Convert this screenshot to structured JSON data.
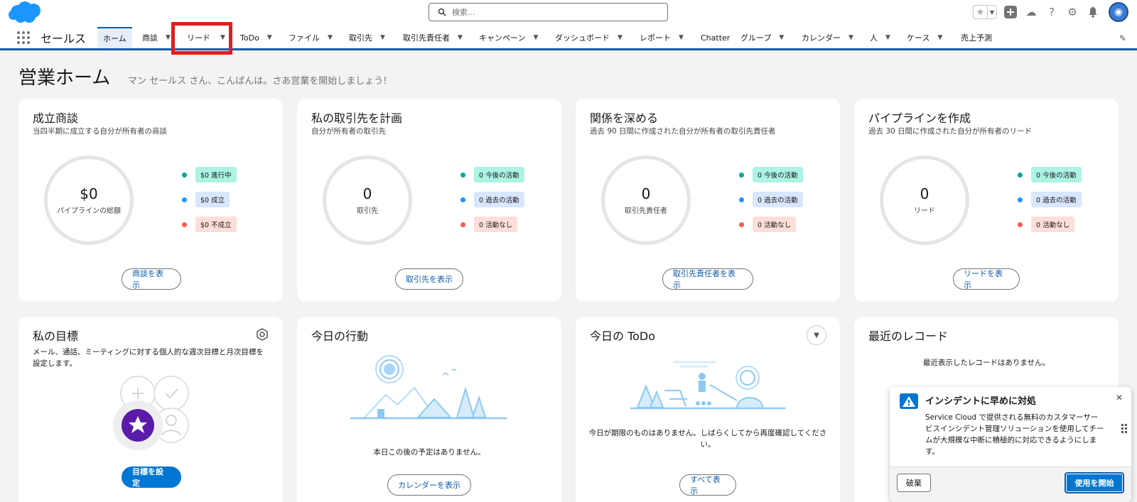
{
  "search": {
    "placeholder": "検索..."
  },
  "nav": {
    "app_name": "セールス",
    "items": [
      {
        "label": "ホーム"
      },
      {
        "label": "商談"
      },
      {
        "label": "リード"
      },
      {
        "label": "ToDo"
      },
      {
        "label": "ファイル"
      },
      {
        "label": "取引先"
      },
      {
        "label": "取引先責任者"
      },
      {
        "label": "キャンペーン"
      },
      {
        "label": "ダッシュボード"
      },
      {
        "label": "レポート"
      },
      {
        "label": "Chatter"
      },
      {
        "label": "グループ"
      },
      {
        "label": "カレンダー"
      },
      {
        "label": "人"
      },
      {
        "label": "ケース"
      },
      {
        "label": "売上予測"
      }
    ]
  },
  "page": {
    "title": "営業ホーム",
    "greeting": "マン セールス さん、こんばんは。さあ営業を開始しましょう!"
  },
  "cards": [
    {
      "title": "成立商談",
      "subtitle": "当四半期に成立する自分が所有者の商談",
      "value": "$0",
      "value_label": "パイプラインの総額",
      "legend": [
        "$0 進行中",
        "$0 成立",
        "$0 不成立"
      ],
      "button": "商談を表示"
    },
    {
      "title": "私の取引先を計画",
      "subtitle": "自分が所有者の取引先",
      "value": "0",
      "value_label": "取引先",
      "legend": [
        "0 今後の活動",
        "0 過去の活動",
        "0 活動なし"
      ],
      "button": "取引先を表示"
    },
    {
      "title": "関係を深める",
      "subtitle": "過去 90 日間に作成された自分が所有者の取引先責任者",
      "value": "0",
      "value_label": "取引先責任者",
      "legend": [
        "0 今後の活動",
        "0 過去の活動",
        "0 活動なし"
      ],
      "button": "取引先責任者を表示"
    },
    {
      "title": "パイプラインを作成",
      "subtitle": "過去 30 日間に作成された自分が所有者のリード",
      "value": "0",
      "value_label": "リード",
      "legend": [
        "0 今後の活動",
        "0 過去の活動",
        "0 活動なし"
      ],
      "button": "リードを表示"
    }
  ],
  "legend_colors": {
    "dots": [
      "#06a59a",
      "#1b96ff",
      "#fe5c4c"
    ],
    "pills": [
      "#acf3e4",
      "#d8e6fe",
      "#feded8"
    ]
  },
  "goals": {
    "title": "私の目標",
    "desc": "メール、通話、ミーティングに対する個人的な週次目標と月次目標を設定します。",
    "button": "目標を設定"
  },
  "events": {
    "title": "今日の行動",
    "empty": "本日この後の予定はありません。",
    "button": "カレンダーを表示"
  },
  "todo": {
    "title": "今日の ToDo",
    "empty": "今日が期限のものはありません。しばらくしてから再度確認してください。",
    "button": "すべて表示"
  },
  "recent": {
    "title": "最近のレコード",
    "empty": "最近表示したレコードはありません。"
  },
  "toast": {
    "title": "インシデントに早めに対処",
    "body": "Service Cloud で提供される無料のカスタマーサービスインシデント管理ソリューションを使用してチームが大規模な中断に積極的に対応できるようにします。",
    "dismiss": "破棄",
    "start": "使用を開始"
  },
  "colors": {
    "brand": "#0b5cab",
    "highlight": "#e21d1d"
  }
}
